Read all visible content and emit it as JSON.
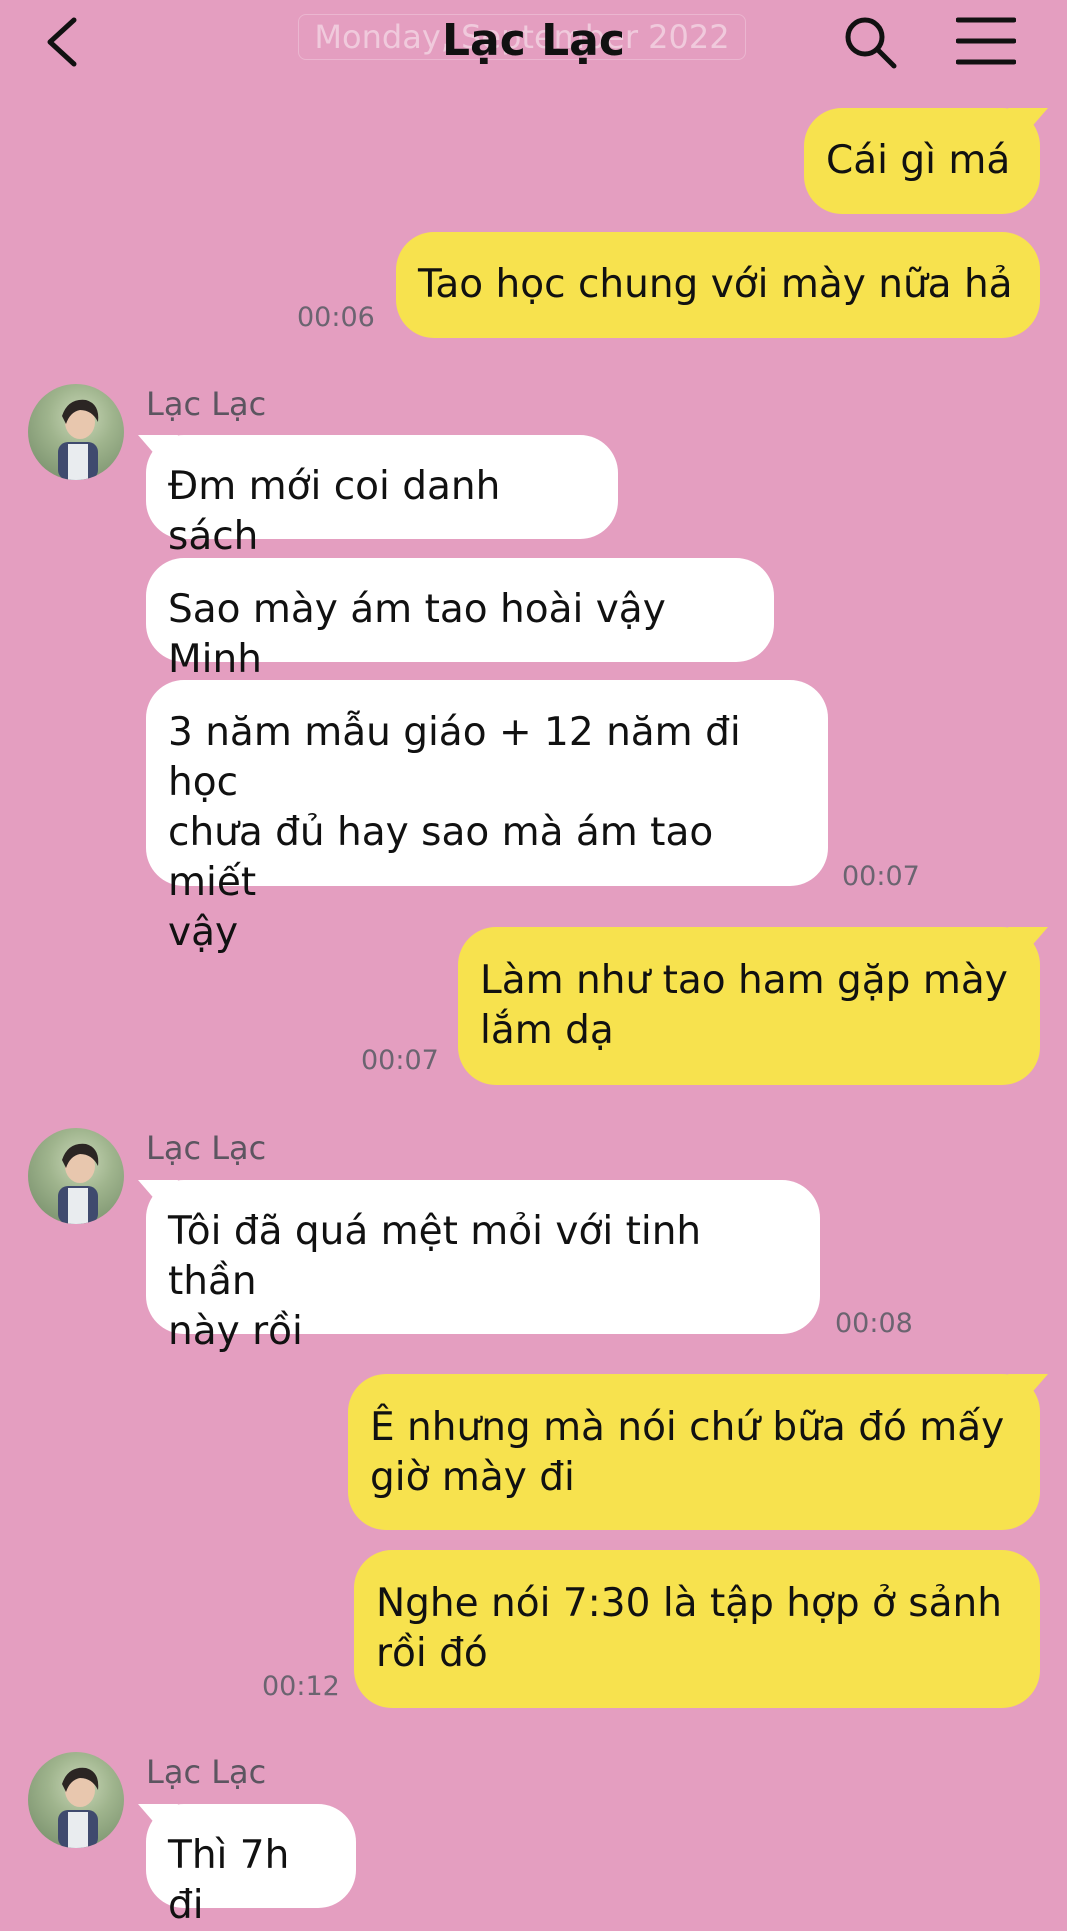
{
  "header": {
    "title": "Lạc Lạc",
    "date_overlay": "Monday, September 2022"
  },
  "colors": {
    "background": "#e49ec0",
    "outgoing_bubble": "#f7e24e",
    "incoming_bubble": "#ffffff"
  },
  "icons": {
    "back": "chevron-left-icon",
    "search": "search-icon",
    "menu": "hamburger-menu-icon"
  },
  "messages": [
    {
      "dir": "out",
      "lines": [
        "Cái gì má"
      ]
    },
    {
      "dir": "out",
      "lines": [
        "Tao học chung với mày nữa hả"
      ],
      "time": "00:06"
    },
    {
      "sender": "Lạc Lạc"
    },
    {
      "dir": "in",
      "lines": [
        "Đm mới coi danh sách"
      ]
    },
    {
      "dir": "in",
      "lines": [
        "Sao mày ám tao hoài vậy Minh"
      ]
    },
    {
      "dir": "in",
      "lines": [
        "3 năm mẫu giáo + 12 năm đi học",
        "chưa đủ hay sao mà ám tao miết",
        "vậy"
      ],
      "time": "00:07"
    },
    {
      "dir": "out",
      "lines": [
        "Làm như tao ham gặp mày",
        "lắm dạ"
      ],
      "time": "00:07"
    },
    {
      "sender": "Lạc Lạc"
    },
    {
      "dir": "in",
      "lines": [
        "Tôi đã quá mệt mỏi với tinh thần",
        "này rồi"
      ],
      "time": "00:08"
    },
    {
      "dir": "out",
      "lines": [
        "Ê nhưng mà nói chứ bữa đó mấy",
        "giờ mày đi"
      ]
    },
    {
      "dir": "out",
      "lines": [
        "Nghe nói 7:30 là tập hợp ở sảnh",
        "rồi đó"
      ],
      "time": "00:12"
    },
    {
      "sender": "Lạc Lạc"
    },
    {
      "dir": "in",
      "lines": [
        "Thì 7h đi"
      ]
    }
  ]
}
